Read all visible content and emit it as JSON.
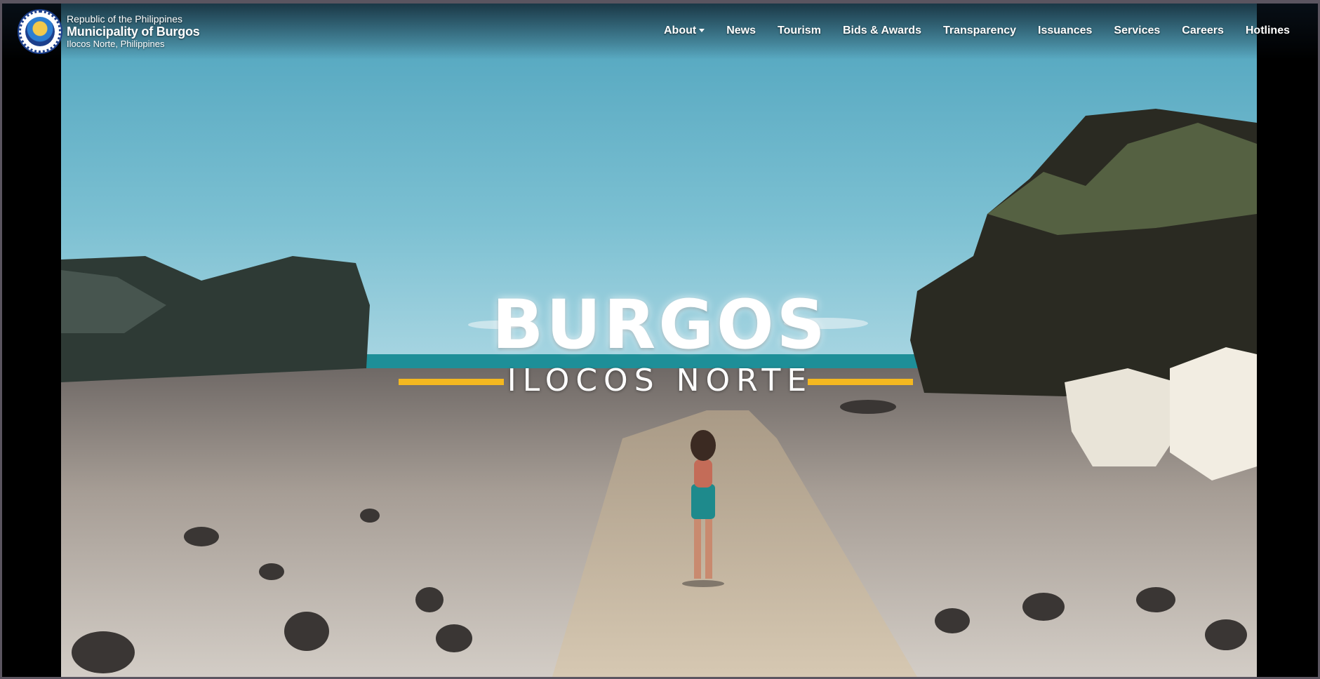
{
  "header": {
    "republic": "Republic of the Philippines",
    "municipality": "Municipality of Burgos",
    "province": "Ilocos Norte, Philippines",
    "seal_icon": "municipal-seal-icon"
  },
  "nav": {
    "items": [
      {
        "label": "About",
        "has_dropdown": true
      },
      {
        "label": "News"
      },
      {
        "label": "Tourism"
      },
      {
        "label": "Bids & Awards"
      },
      {
        "label": "Transparency"
      },
      {
        "label": "Issuances"
      },
      {
        "label": "Services"
      },
      {
        "label": "Careers"
      },
      {
        "label": "Hotlines"
      }
    ]
  },
  "hero": {
    "title": "BURGOS",
    "subtitle": "ILOCOS NORTE",
    "accent_color": "#f4b820"
  }
}
